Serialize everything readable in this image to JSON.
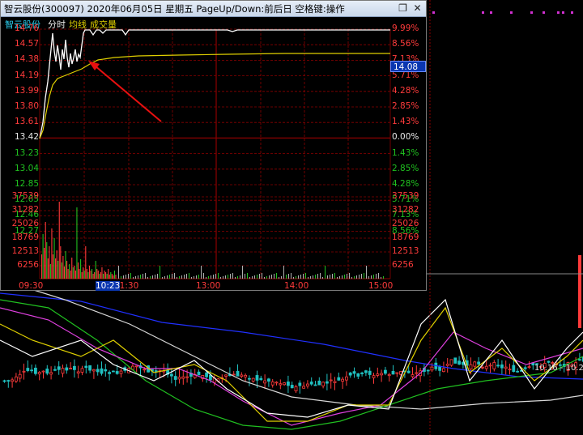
{
  "window": {
    "title": "智云股份(300097) 2020年06月05日 星期五 PageUp/Down:前后日 空格键:操作",
    "restore_glyph": "❐",
    "close_glyph": "✕"
  },
  "legend": {
    "stock": "智云股份",
    "minute": "分时",
    "avg": "均线",
    "volume": "成交量"
  },
  "price_axis": {
    "left_labels": [
      "14.76",
      "14.57",
      "14.38",
      "14.19",
      "13.99",
      "13.80",
      "13.61",
      "13.42",
      "13.23",
      "13.04",
      "12.85",
      "12.65",
      "12.46",
      "12.27"
    ],
    "right_labels": [
      "9.99%",
      "8.56%",
      "7.13%",
      "5.71%",
      "4.28%",
      "2.85%",
      "1.43%",
      "0.00%",
      "1.43%",
      "2.85%",
      "4.28%",
      "5.71%",
      "7.13%",
      "8.56%"
    ],
    "current_price": "14.08"
  },
  "volume_axis": {
    "labels": [
      "37539",
      "31282",
      "25026",
      "18769",
      "12513",
      "6256"
    ]
  },
  "time_axis": {
    "labels": [
      "09:30",
      "11:30",
      "13:00",
      "14:00",
      "15:00"
    ],
    "cursor_time": "10:23"
  },
  "colors": {
    "up": "#ff3b3b",
    "down": "#20c020",
    "price_line": "#ffffff",
    "avg_line": "#e0d000",
    "grid": "#8b0000",
    "title_bg": "#dbe5f3",
    "cursor_bg": "#0a36b0"
  },
  "bg_chart": {
    "right_label": "10.16 - 10.2"
  },
  "annotation": {
    "type": "red arrow pointing at average line"
  }
}
